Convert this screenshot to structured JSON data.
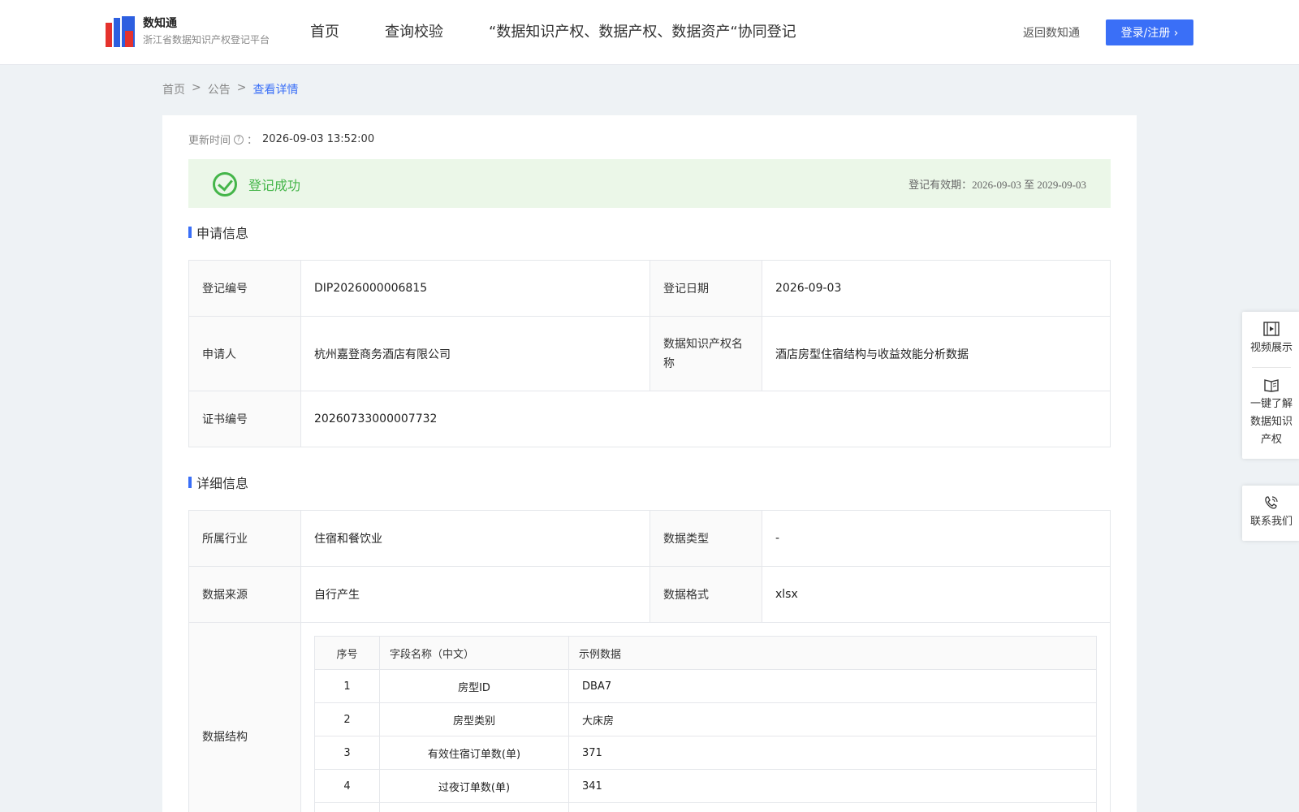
{
  "header": {
    "logo_title": "数知通",
    "logo_subtitle": "浙江省数据知识产权登记平台",
    "nav": [
      "首页",
      "查询校验",
      "“数据知识产权、数据产权、数据资产“协同登记"
    ],
    "back_link": "返回数知通",
    "login_label": "登录/注册 ›"
  },
  "breadcrumb": [
    "首页",
    ">",
    "公告",
    ">",
    "查看详情"
  ],
  "update": {
    "label": "更新时间",
    "colon": "：",
    "value": "2026-09-03 13:52:00"
  },
  "status": {
    "label": "登记成功",
    "validity": "登记有效期：2026-09-03 至 2029-09-03",
    "color": "#44b549"
  },
  "apply_section": {
    "title": "申请信息",
    "reg_no_label": "登记编号",
    "reg_no": "DIP2026000006815",
    "reg_date_label": "登记日期",
    "reg_date": "2026-09-03",
    "applicant_label": "申请人",
    "applicant": "杭州嘉登商务酒店有限公司",
    "ip_name_label": "数据知识产权名称",
    "ip_name": "酒店房型住宿结构与收益效能分析数据",
    "cert_no_label": "证书编号",
    "cert_no": "20260733000007732"
  },
  "detail_section": {
    "title": "详细信息",
    "industry_label": "所属行业",
    "industry": "住宿和餐饮业",
    "data_type_label": "数据类型",
    "data_type": "-",
    "source_label": "数据来源",
    "source": "自行产生",
    "format_label": "数据格式",
    "format": "xlsx",
    "structure_label": "数据结构",
    "structure_headers": [
      "序号",
      "字段名称（中文）",
      "示例数据"
    ],
    "structure_rows": [
      [
        "1",
        "房型ID",
        "DBA7"
      ],
      [
        "2",
        "房型类别",
        "大床房"
      ],
      [
        "3",
        "有效住宿订单数(单)",
        "371"
      ],
      [
        "4",
        "过夜订单数(单)",
        "341"
      ],
      [
        "",
        "",
        ""
      ]
    ]
  },
  "side": {
    "video": "视频展示",
    "learn": "一键了解数据知识产权",
    "contact": "联系我们"
  },
  "colors": {
    "accent": "#3a6ff7",
    "success": "#44b549",
    "success_bg": "#ebf7e8"
  }
}
